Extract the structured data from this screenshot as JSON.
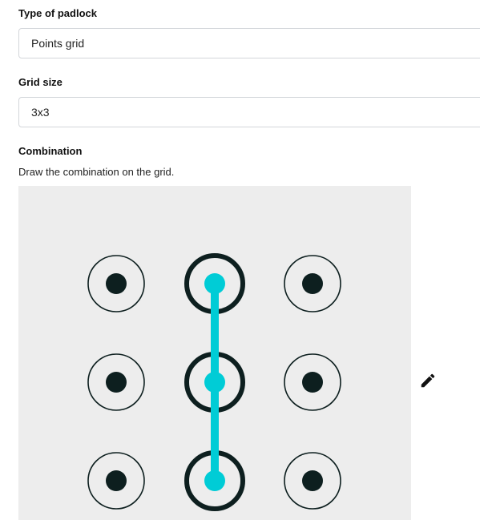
{
  "padlock_type": {
    "label": "Type of padlock",
    "value": "Points grid"
  },
  "grid_size": {
    "label": "Grid size",
    "value": "3x3"
  },
  "combination": {
    "label": "Combination",
    "hint": "Draw the combination on the grid.",
    "grid_rows": 3,
    "grid_cols": 3,
    "selected_points": [
      [
        0,
        1
      ],
      [
        1,
        1
      ],
      [
        2,
        1
      ]
    ],
    "colors": {
      "background": "#ededed",
      "point": "#0d1f1f",
      "path": "#00ccd6"
    },
    "edit_icon": "pencil-icon"
  }
}
